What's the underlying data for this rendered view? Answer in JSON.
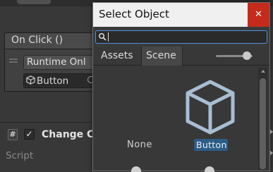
{
  "inspector": {
    "event_header": "On Click ()",
    "runtime_dropdown": "Runtime Onl",
    "object_field": "Button",
    "component_checkbox": "✓",
    "component_title": "Change C",
    "script_label": "Script",
    "script_glyph": "#"
  },
  "dialog": {
    "title": "Select Object",
    "close_glyph": "✕",
    "search": {
      "value": "",
      "placeholder": ""
    },
    "tabs": [
      {
        "label": "Assets",
        "active": false
      },
      {
        "label": "Scene",
        "active": true
      }
    ],
    "zoom_slider_value": 0.75,
    "items": [
      {
        "label": "None",
        "selected": false
      },
      {
        "label": "Button",
        "selected": true,
        "icon": "cube-icon"
      }
    ]
  },
  "colors": {
    "selection": "#2c5d87",
    "close_button": "#c42b1c",
    "search_focus": "#4f92d8"
  }
}
